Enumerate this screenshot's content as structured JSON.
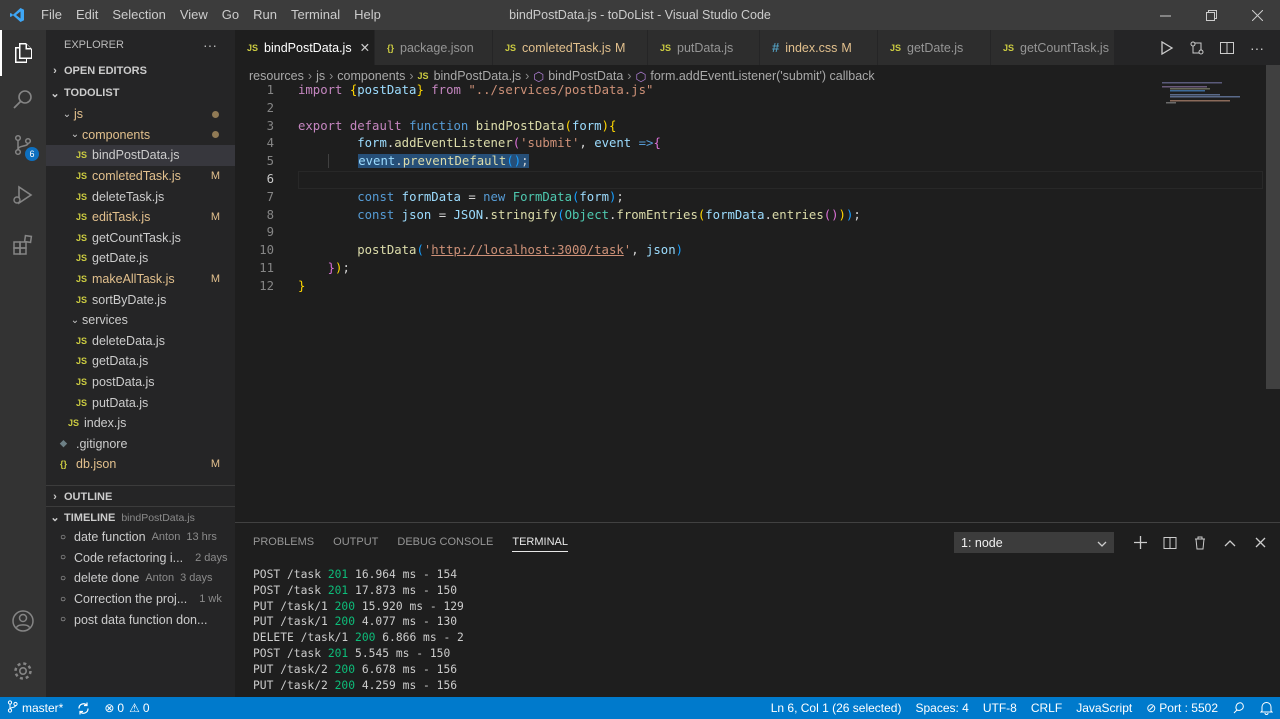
{
  "titlebar": {
    "menu": [
      "File",
      "Edit",
      "Selection",
      "View",
      "Go",
      "Run",
      "Terminal",
      "Help"
    ],
    "title": "bindPostData.js - toDoList - Visual Studio Code"
  },
  "activity": {
    "scm_badge": "6"
  },
  "explorer": {
    "header": "EXPLORER",
    "more": "···",
    "open_editors": "OPEN EDITORS",
    "project": "TODOLIST",
    "tree": [
      {
        "label": "js",
        "type": "folder",
        "indent": 1,
        "dot": true
      },
      {
        "label": "components",
        "type": "folder",
        "indent": 2,
        "dot": true
      },
      {
        "label": "bindPostData.js",
        "type": "file",
        "indent": 3,
        "selected": true
      },
      {
        "label": "comletedTask.js",
        "type": "file",
        "indent": 3,
        "flag": "M"
      },
      {
        "label": "deleteTask.js",
        "type": "file",
        "indent": 3
      },
      {
        "label": "editTask.js",
        "type": "file",
        "indent": 3,
        "flag": "M"
      },
      {
        "label": "getCountTask.js",
        "type": "file",
        "indent": 3
      },
      {
        "label": "getDate.js",
        "type": "file",
        "indent": 3
      },
      {
        "label": "makeAllTask.js",
        "type": "file",
        "indent": 3,
        "flag": "M"
      },
      {
        "label": "sortByDate.js",
        "type": "file",
        "indent": 3
      },
      {
        "label": "services",
        "type": "folder",
        "indent": 2
      },
      {
        "label": "deleteData.js",
        "type": "file",
        "indent": 3
      },
      {
        "label": "getData.js",
        "type": "file",
        "indent": 3
      },
      {
        "label": "postData.js",
        "type": "file",
        "indent": 3
      },
      {
        "label": "putData.js",
        "type": "file",
        "indent": 3
      },
      {
        "label": "index.js",
        "type": "file",
        "indent": 2
      },
      {
        "label": ".gitignore",
        "type": "git",
        "indent": 1
      },
      {
        "label": "db.json",
        "type": "json",
        "indent": 1,
        "flag": "M"
      }
    ],
    "outline": "OUTLINE",
    "timeline": "TIMELINE",
    "timeline_file": "bindPostData.js",
    "timeline_items": [
      {
        "label": "date function",
        "author": "Anton",
        "time": "13 hrs"
      },
      {
        "label": "Code refactoring i...",
        "author": "",
        "time": "2 days"
      },
      {
        "label": "delete done",
        "author": "Anton",
        "time": "3 days"
      },
      {
        "label": "Correction the proj...",
        "author": "",
        "time": "1 wk"
      },
      {
        "label": "post data function don...",
        "author": "",
        "time": ""
      }
    ]
  },
  "tabs": [
    {
      "label": "bindPostData.js",
      "icon": "JS",
      "active": true,
      "close": "✕"
    },
    {
      "label": "package.json",
      "icon": "{}"
    },
    {
      "label": "comletedTask.js",
      "icon": "JS",
      "flag": "M"
    },
    {
      "label": "putData.js",
      "icon": "JS"
    },
    {
      "label": "index.css",
      "icon": "#",
      "flag": "M"
    },
    {
      "label": "getDate.js",
      "icon": "JS"
    },
    {
      "label": "getCountTask.js",
      "icon": "JS"
    }
  ],
  "breadcrumbs": [
    "resources",
    "js",
    "components",
    "bindPostData.js",
    "bindPostData",
    "form.addEventListener('submit') callback"
  ],
  "editor": {
    "line_numbers": [
      "1",
      "2",
      "3",
      "4",
      "5",
      "6",
      "7",
      "8",
      "9",
      "10",
      "11",
      "12"
    ],
    "current_line": "6"
  },
  "panel": {
    "tabs": [
      "PROBLEMS",
      "OUTPUT",
      "DEBUG CONSOLE",
      "TERMINAL"
    ],
    "active_tab": "TERMINAL",
    "terminal_select": "1: node",
    "lines": [
      {
        "pre": "POST /task ",
        "status": "201",
        "post": " 16.964 ms - 154"
      },
      {
        "pre": "POST /task ",
        "status": "201",
        "post": " 17.873 ms - 150"
      },
      {
        "pre": "PUT /task/1 ",
        "status": "200",
        "post": " 15.920 ms - 129"
      },
      {
        "pre": "PUT /task/1 ",
        "status": "200",
        "post": " 4.077 ms - 130"
      },
      {
        "pre": "DELETE /task/1 ",
        "status": "200",
        "post": " 6.866 ms - 2"
      },
      {
        "pre": "POST /task ",
        "status": "201",
        "post": " 5.545 ms - 150"
      },
      {
        "pre": "PUT /task/2 ",
        "status": "200",
        "post": " 6.678 ms - 156"
      },
      {
        "pre": "PUT /task/2 ",
        "status": "200",
        "post": " 4.259 ms - 156"
      }
    ]
  },
  "statusbar": {
    "branch": "master*",
    "errors": "0",
    "warnings": "0",
    "position": "Ln 6, Col 1 (26 selected)",
    "spaces": "Spaces: 4",
    "encoding": "UTF-8",
    "eol": "CRLF",
    "language": "JavaScript",
    "port": "Port : 5502"
  }
}
